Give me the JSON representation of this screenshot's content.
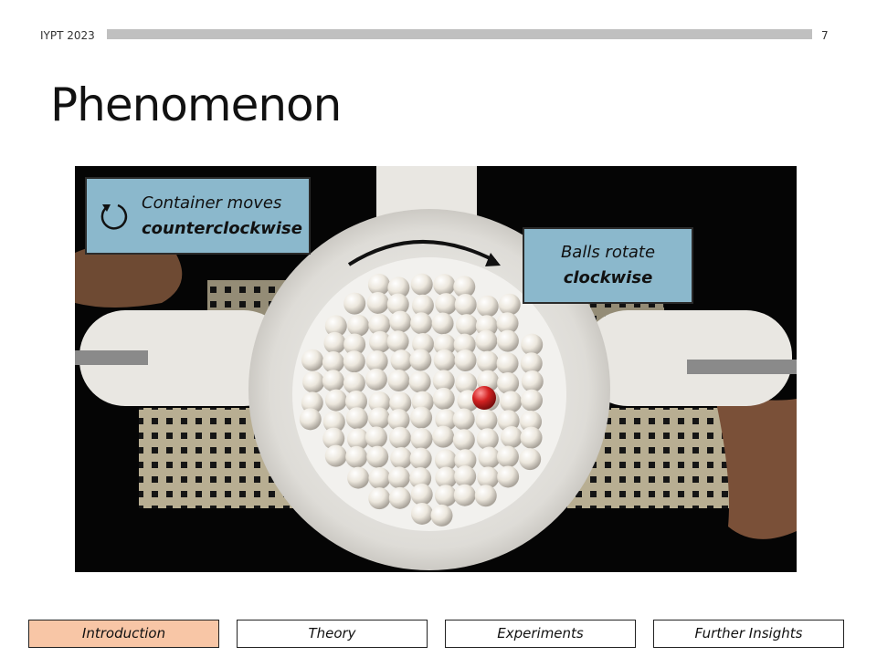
{
  "header": {
    "event": "IYPT 2023",
    "page_number": "7"
  },
  "slide": {
    "title": "Phenomenon"
  },
  "photo": {
    "callout_left": {
      "line1": "Container moves",
      "line2": "counterclockwise",
      "icon": "counterclockwise-arrow-icon"
    },
    "callout_right": {
      "line1": "Balls rotate",
      "line2": "clockwise"
    },
    "arrow_icon": "clockwise-arc-arrow",
    "colors": {
      "callout_bg": "#8bb8cc",
      "ball": "#ece7dd",
      "highlight_ball": "#c81e1e"
    }
  },
  "nav": {
    "items": [
      {
        "label": "Introduction",
        "active": true
      },
      {
        "label": "Theory",
        "active": false
      },
      {
        "label": "Experiments",
        "active": false
      },
      {
        "label": "Further Insights",
        "active": false
      }
    ],
    "active_color": "#f8c6a6"
  }
}
